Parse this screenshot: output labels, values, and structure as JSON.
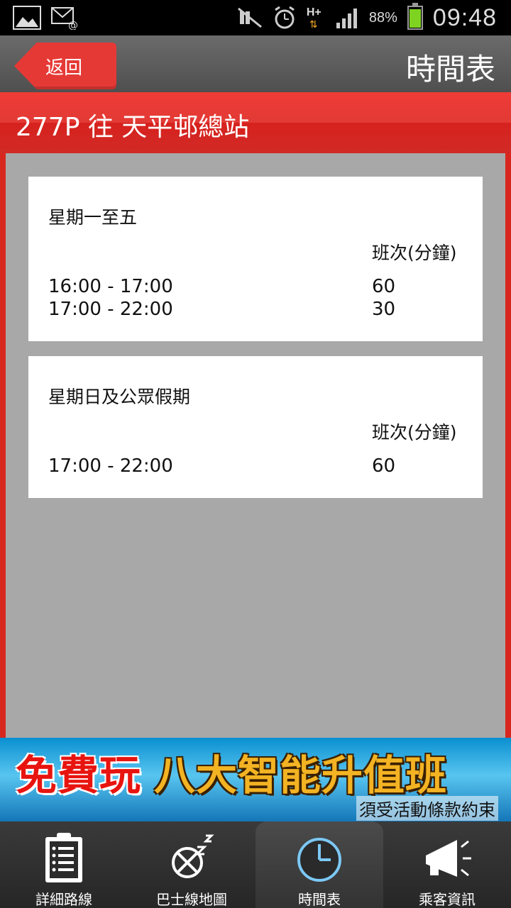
{
  "status_bar": {
    "battery_percent": "88%",
    "network": "H+",
    "time": "09:48",
    "icons": [
      "picture-icon",
      "email-icon",
      "mute-icon",
      "alarm-icon",
      "hplus-icon",
      "signal-icon",
      "battery-icon"
    ]
  },
  "header": {
    "back_label": "返回",
    "title": "時間表"
  },
  "route": {
    "title": "277P 往 天平邨總站"
  },
  "schedule": [
    {
      "day": "星期一至五",
      "freq_header": "班次(分鐘)",
      "rows": [
        {
          "time": "16:00 - 17:00",
          "freq": "60"
        },
        {
          "time": "17:00 - 22:00",
          "freq": "30"
        }
      ]
    },
    {
      "day": "星期日及公眾假期",
      "freq_header": "班次(分鐘)",
      "rows": [
        {
          "time": "17:00 - 22:00",
          "freq": "60"
        }
      ]
    }
  ],
  "banner": {
    "main_red": "免費玩",
    "main_gold": "八大智能升值班",
    "sub": "須受活動條款約束"
  },
  "bottom_nav": {
    "items": [
      {
        "label": "詳細路線",
        "icon": "clipboard-icon"
      },
      {
        "label": "巴士線地圖",
        "icon": "map-icon"
      },
      {
        "label": "時間表",
        "icon": "clock-icon",
        "active": true
      },
      {
        "label": "乘客資訊",
        "icon": "megaphone-icon"
      }
    ]
  },
  "colors": {
    "accent_red": "#e53935",
    "active_clock_blue": "#7cc8f5",
    "battery_green": "#7ed321"
  }
}
